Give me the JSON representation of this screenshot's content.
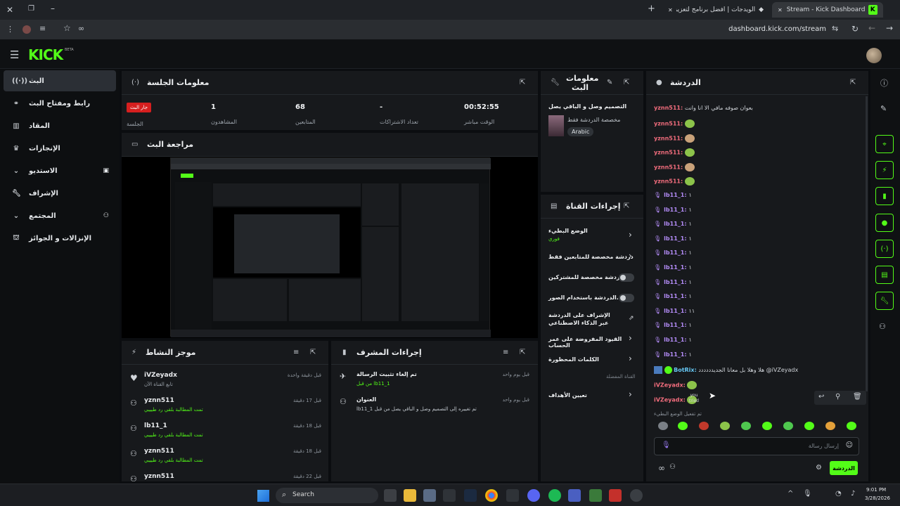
{
  "browser": {
    "tabs": [
      {
        "label": "Stream - Kick Dashboard",
        "active": true
      },
      {
        "label": "الويدجات | أفضل برنامج لتعزيز البث",
        "active": false
      }
    ],
    "url": "dashboard.kick.com/stream"
  },
  "header": {
    "logo": "KICK",
    "beta": "BETA"
  },
  "nav": {
    "items": [
      {
        "label": "البث",
        "icon": "broadcast-icon"
      },
      {
        "label": "رابط ومفتاح البث",
        "icon": "link-icon"
      },
      {
        "label": "المقاد",
        "icon": "chart-icon"
      },
      {
        "label": "الإنجازات",
        "icon": "trophy-icon"
      },
      {
        "label": "الاستديو",
        "icon": "studio-icon"
      },
      {
        "label": "الإشراف",
        "icon": "wrench-icon"
      },
      {
        "label": "المجتمع",
        "icon": "community-icon"
      },
      {
        "label": "الإنزالات و الجوائز",
        "icon": "gift-icon"
      }
    ]
  },
  "session": {
    "title": "معلومات الجلسة",
    "live_badge": "جار البث",
    "session_label": "الجلسة",
    "stats": [
      {
        "value": "1",
        "label": "المشاهدون"
      },
      {
        "value": "68",
        "label": "المتابعين"
      },
      {
        "value": "-",
        "label": "تعداد الاشتراكات"
      },
      {
        "value": "00:52:55",
        "label": "الوقت مباشر"
      }
    ]
  },
  "preview": {
    "title": "مراجعة البث"
  },
  "stream_info": {
    "title": "معلومات البث",
    "stream_title": "التصميم وصل و الباقي يصل",
    "category": "مخصصة الدردشة فقط",
    "language": "Arabic"
  },
  "channel_actions": {
    "title": "إجراءات القناة",
    "items": [
      {
        "label": "الوضع البطيء",
        "sub": "فوري",
        "control": "chevron"
      },
      {
        "label": "دردشة مخصصة للمتابعين فقط",
        "sub": "",
        "control": "chevron"
      },
      {
        "label": "الدردشة مخصصة للمشتركين...",
        "sub": "",
        "control": "toggle"
      },
      {
        "label": "الدردشة باستخدام الصور...",
        "sub": "",
        "control": "toggle"
      },
      {
        "label": "الإشراف على الدردشة عبر الذكاء الاصطناعي",
        "sub": "",
        "control": "external"
      },
      {
        "label": "القيود المفروضة على عمر الحساب",
        "sub": "",
        "control": "chevron"
      },
      {
        "label": "الكلمات المحظورة",
        "sub": "",
        "control": "chevron"
      }
    ],
    "section_label": "القناة المفضلة",
    "targets_label": "تعيين الأهداف"
  },
  "activity": {
    "title": "موجز النشاط",
    "rows": [
      {
        "name": "iVZeyadx",
        "sub": "تابع القناة الآن",
        "time": "قبل دقيقة واحدة",
        "icon": "heart-icon"
      },
      {
        "name": "yznn511",
        "sub": "تمت المطالبة بلقي رد طيييي",
        "time": "قبل 17 دقيقة",
        "icon": "users-icon"
      },
      {
        "name": "lb11_1",
        "sub": "تمت المطالبة بلقي رد طيييي",
        "time": "قبل 18 دقيقة",
        "icon": "users-icon"
      },
      {
        "name": "yznn511",
        "sub": "تمت المطالبة بلقي رد طيييي",
        "time": "قبل 18 دقيقة",
        "icon": "users-icon"
      },
      {
        "name": "yznn511",
        "sub": "",
        "time": "قبل 22 دقيقة",
        "icon": "users-icon"
      }
    ]
  },
  "mod_actions": {
    "title": "إجراءات المشرف",
    "rows": [
      {
        "title": "تم إلغاء تثبيت الرسالة",
        "sub": "من قبل lb11_1",
        "time": "قبل يوم واحد"
      },
      {
        "title": "العنوان",
        "sub": "lb11_1 تم تغييره إلى التصميم وصل و الباقي يصل من قبل",
        "time": "قبل يوم واحد"
      }
    ]
  },
  "chat": {
    "title": "الدردشة",
    "first_message": {
      "user": "yznn511:",
      "text": "بعوان صوفه مافي الا انا وانت"
    },
    "messages": [
      {
        "user": "yznn511:",
        "color": "#f26d7d",
        "text": ""
      },
      {
        "user": "yznn511:",
        "color": "#f26d7d",
        "text": ""
      },
      {
        "user": "yznn511:",
        "color": "#f26d7d",
        "text": ""
      },
      {
        "user": "yznn511:",
        "color": "#f26d7d",
        "text": ""
      },
      {
        "user": "yznn511:",
        "color": "#f26d7d",
        "text": ""
      },
      {
        "user": "lb11_1:",
        "color": "#b28bf5",
        "text": "١"
      },
      {
        "user": "lb11_1:",
        "color": "#b28bf5",
        "text": "١"
      },
      {
        "user": "lb11_1:",
        "color": "#b28bf5",
        "text": "١"
      },
      {
        "user": "lb11_1:",
        "color": "#b28bf5",
        "text": "١"
      },
      {
        "user": "lb11_1:",
        "color": "#b28bf5",
        "text": "١"
      },
      {
        "user": "lb11_1:",
        "color": "#b28bf5",
        "text": "١"
      },
      {
        "user": "lb11_1:",
        "color": "#b28bf5",
        "text": "١"
      },
      {
        "user": "lb11_1:",
        "color": "#b28bf5",
        "text": "١"
      },
      {
        "user": "lb11_1:",
        "color": "#b28bf5",
        "text": "١١"
      },
      {
        "user": "lb11_1:",
        "color": "#b28bf5",
        "text": "١"
      },
      {
        "user": "lb11_1:",
        "color": "#b28bf5",
        "text": "١"
      },
      {
        "user": "lb11_1:",
        "color": "#b28bf5",
        "text": "١"
      }
    ],
    "bot": {
      "user": "BotRix:",
      "text": "هلا وهلا بل معانا الجديدددددد @iVZeyadx"
    },
    "zeyad": [
      {
        "user": "iVZeyadx:"
      },
      {
        "user": "iVZeyadx:"
      }
    ],
    "emote_caption": "you tried",
    "slow_mode_note": "تم تفعيل الوضع البطيء",
    "input_placeholder": "إرسال رسالة",
    "send_label": "الدردشة"
  },
  "taskbar": {
    "search": "Search",
    "time": "9:01 PM",
    "date": "3/28/2026"
  },
  "colors": {
    "accent": "#53fc18",
    "live": "#d61f1f"
  }
}
